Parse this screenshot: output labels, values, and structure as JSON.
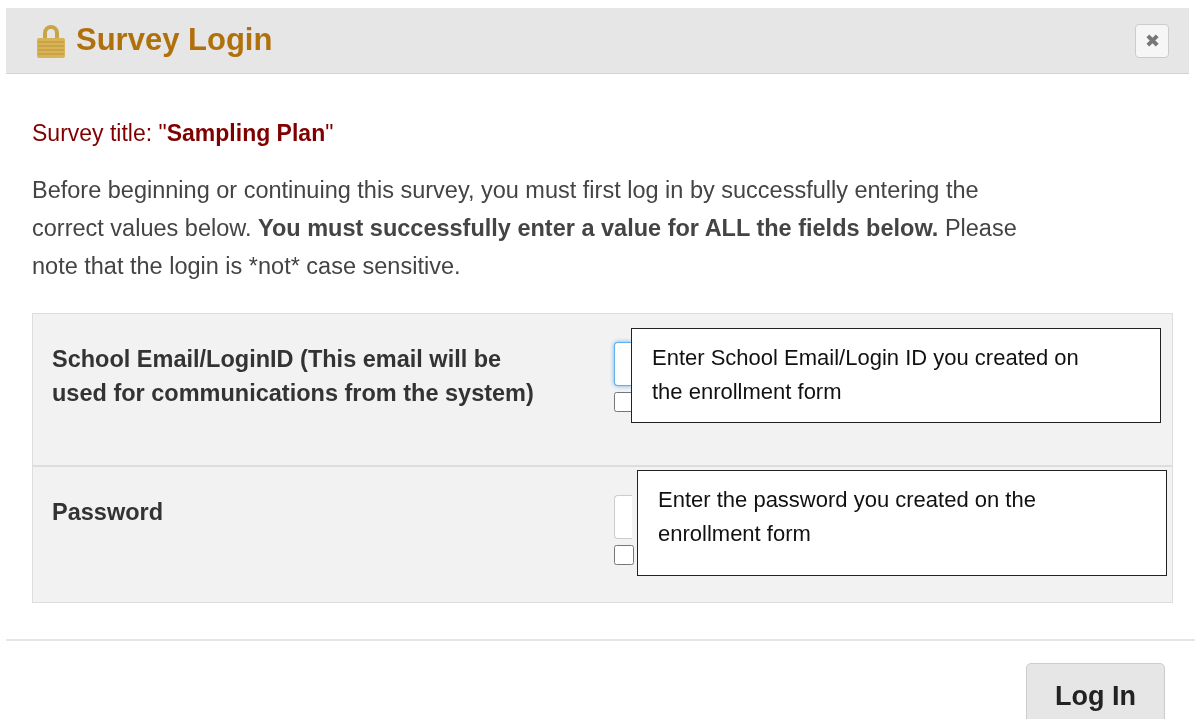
{
  "dialog": {
    "title": "Survey Login",
    "close_label": "✖"
  },
  "survey_title": {
    "label": "Survey title: \"",
    "name": "Sampling Plan",
    "suffix": "\""
  },
  "instructions": [
    {
      "text": "Before beginning or continuing this survey, you must first log in by successfully entering the correct values below. ",
      "bold": false
    },
    {
      "text": "You must successfully enter a value for ALL the fields below.",
      "bold": true
    },
    {
      "text": " Please note that the login is *not* case sensitive.",
      "bold": false
    }
  ],
  "fields": [
    {
      "label": "School Email/LoginID (This email will be used for communications from the system)",
      "focused": true,
      "show_checked": false,
      "callout": "Enter School Email/Login ID you created on the enrollment form"
    },
    {
      "label": "Password",
      "focused": false,
      "show_checked": false,
      "callout": "Enter the password you created on the enrollment form"
    }
  ],
  "buttons": [
    {
      "label": "Log In"
    }
  ]
}
